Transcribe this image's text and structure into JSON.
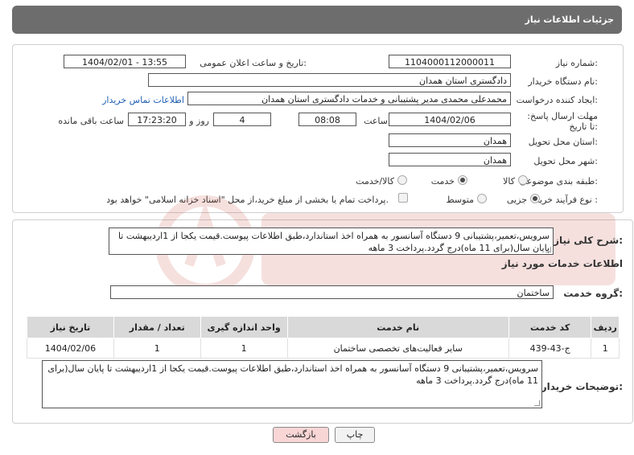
{
  "header": {
    "title": "جزئیات اطلاعات نیاز"
  },
  "form": {
    "need_number": {
      "label": "شماره نیاز:",
      "value": "1104000112000011"
    },
    "announce_datetime": {
      "label": "تاریخ و ساعت اعلان عمومی:",
      "value": "1404/02/01 - 13:55"
    },
    "buyer_org": {
      "label": "نام دستگاه خریدار:",
      "value": "دادگستری استان همدان"
    },
    "requester": {
      "label": "ایجاد کننده درخواست:",
      "value": "محمدعلی محمدی مدیر پشتیبانی و خدمات دادگستری استان همدان",
      "contact_link": "اطلاعات تماس خریدار"
    },
    "deadline": {
      "label": "مهلت ارسال پاسخ: تا تاریخ:",
      "date": "1404/02/06",
      "time_label": "ساعت",
      "time": "08:08",
      "days": "4",
      "days_label": "روز و",
      "remaining": "17:23:20",
      "remaining_label": "ساعت باقی مانده"
    },
    "province": {
      "label": "استان محل تحویل:",
      "value": "همدان"
    },
    "city": {
      "label": "شهر محل تحویل:",
      "value": "همدان"
    },
    "category": {
      "label": "طبقه بندی موضوعی:",
      "options": [
        "کالا",
        "خدمت",
        "کالا/خدمت"
      ],
      "selected": "خدمت"
    },
    "purchase_type": {
      "label": "نوع فرآیند خرید :",
      "options": [
        "جزیی",
        "متوسط"
      ],
      "selected": "جزیی",
      "treasury_note": "پرداخت تمام یا بخشی از مبلغ خرید،از محل \"اسناد خزانه اسلامی\" خواهد بود."
    }
  },
  "summary": {
    "label": "شرح کلی نیاز:",
    "text": "سرویس،تعمیر،پشتیبانی 9 دستگاه آسانسور به همراه اخذ استاندارد،طبق اطلاعات پیوست.قیمت یکجا از 1اردیبهشت تا پایان سال(برای 11 ماه)درج گردد.پرداخت 3 ماهه"
  },
  "services": {
    "title": "اطلاعات خدمات مورد نیاز",
    "group_label": "گروه خدمت:",
    "group_value": "ساختمان",
    "columns": [
      "ردیف",
      "کد خدمت",
      "نام خدمت",
      "واحد اندازه گیری",
      "تعداد / مقدار",
      "تاریخ نیاز"
    ],
    "rows": [
      [
        "1",
        "ج-43-439",
        "سایر فعالیت‌های تخصصی ساختمان",
        "1",
        "1",
        "1404/02/06"
      ]
    ]
  },
  "buyer_notes": {
    "label": "توضیحات خریدار:",
    "text": "سرویس،تعمیر،پشتیبانی 9 دستگاه آسانسور به همراه اخذ استاندارد،طبق اطلاعات پیوست.قیمت یکجا از 1اردیبهشت تا پایان سال(برای 11 ماه)درج گردد.پرداخت 3 ماهه"
  },
  "buttons": {
    "print": "چاپ",
    "back": "بازگشت"
  },
  "colors": {
    "header_bg": "#6d6d6d",
    "back_button_bg": "#f9d6d6",
    "link": "#1f5fb5"
  }
}
